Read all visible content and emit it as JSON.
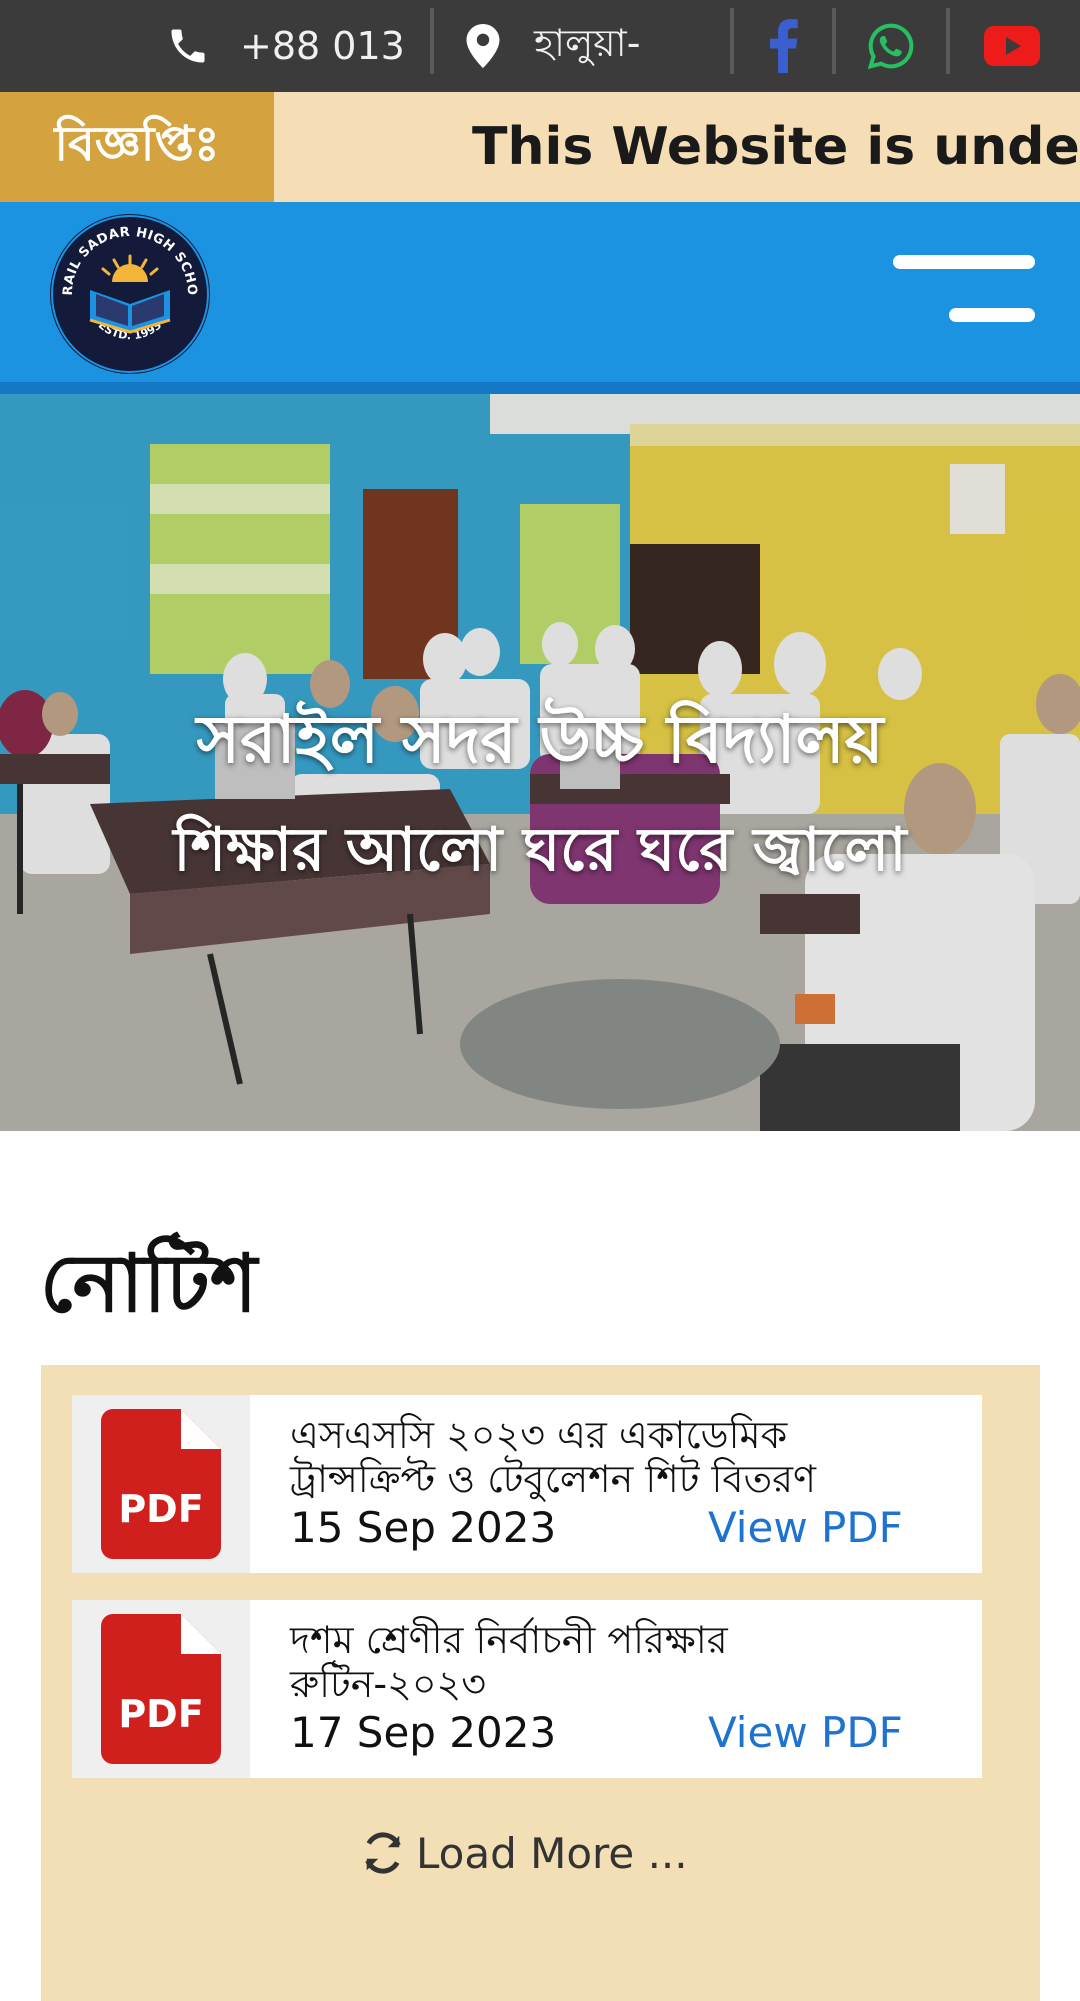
{
  "topbar": {
    "phone": "+88 013",
    "location": "হালুয়া-",
    "icons": [
      "phone-icon",
      "location-pin-icon",
      "facebook-icon",
      "whatsapp-icon",
      "youtube-icon"
    ]
  },
  "notice_bar": {
    "label": "বিজ্ঞপ্তিঃ",
    "text": "This Website is under n"
  },
  "header": {
    "logo_top_text": "SARAIL SADAR HIGH SCHOOL",
    "logo_estd": "ESTD. 1993"
  },
  "hero": {
    "title": "সরাইল সদর উচ্চ বিদ্যালয়",
    "subtitle": "শিক্ষার আলো ঘরে ঘরে জ্বালো"
  },
  "notices": {
    "heading": "নোটিশ",
    "items": [
      {
        "title": "এসএসসি ২০২৩ এর একাডেমিক ট্রান্সক্রিপ্ট ও টেবুলেশন শিট বিতরণ",
        "date": "15 Sep 2023",
        "link": "View PDF"
      },
      {
        "title": "দশম শ্রেণীর নির্বাচনী পরিক্ষার রুটিন-২০২৩",
        "date": "17 Sep 2023",
        "link": "View PDF"
      }
    ],
    "load_more": "Load More ...",
    "pdf_badge": "PDF"
  },
  "colors": {
    "topbar": "#3b3b3b",
    "notice_label": "#d4a23f",
    "notice_bg": "#f5deb5",
    "header": "#1b93e0",
    "panel": "#f3dfb5",
    "link": "#1e73d0",
    "pdf_red": "#d0201d"
  }
}
